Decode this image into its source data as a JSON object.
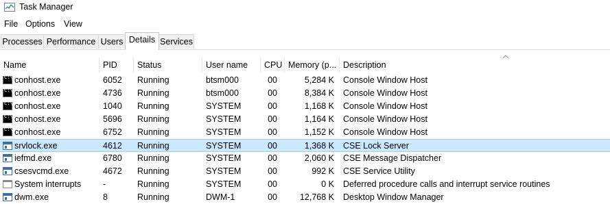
{
  "window": {
    "title": "Task Manager",
    "icon": "task-manager-icon"
  },
  "menu": [
    {
      "label": "File"
    },
    {
      "label": "Options"
    },
    {
      "label": "View"
    }
  ],
  "tabs": [
    {
      "label": "Processes",
      "active": false
    },
    {
      "label": "Performance",
      "active": false
    },
    {
      "label": "Users",
      "active": false
    },
    {
      "label": "Details",
      "active": true
    },
    {
      "label": "Services",
      "active": false
    }
  ],
  "columns": {
    "name": "Name",
    "pid": "PID",
    "status": "Status",
    "user": "User name",
    "cpu": "CPU",
    "memory": "Memory (p...",
    "description": "Description"
  },
  "rows": [
    {
      "icon": "console-icon",
      "name": "conhost.exe",
      "pid": "6052",
      "status": "Running",
      "user": "btsm000",
      "cpu": "00",
      "memory": "5,284 K",
      "description": "Console Window Host",
      "selected": false
    },
    {
      "icon": "console-icon",
      "name": "conhost.exe",
      "pid": "4736",
      "status": "Running",
      "user": "btsm000",
      "cpu": "00",
      "memory": "8,384 K",
      "description": "Console Window Host",
      "selected": false
    },
    {
      "icon": "console-icon",
      "name": "conhost.exe",
      "pid": "1040",
      "status": "Running",
      "user": "SYSTEM",
      "cpu": "00",
      "memory": "1,168 K",
      "description": "Console Window Host",
      "selected": false
    },
    {
      "icon": "console-icon",
      "name": "conhost.exe",
      "pid": "5696",
      "status": "Running",
      "user": "SYSTEM",
      "cpu": "00",
      "memory": "1,164 K",
      "description": "Console Window Host",
      "selected": false
    },
    {
      "icon": "console-icon",
      "name": "conhost.exe",
      "pid": "6752",
      "status": "Running",
      "user": "SYSTEM",
      "cpu": "00",
      "memory": "1,152 K",
      "description": "Console Window Host",
      "selected": false
    },
    {
      "icon": "app-window-icon",
      "name": "srvlock.exe",
      "pid": "4612",
      "status": "Running",
      "user": "SYSTEM",
      "cpu": "00",
      "memory": "1,368 K",
      "description": "CSE Lock Server",
      "selected": true
    },
    {
      "icon": "app-window-icon",
      "name": "iefmd.exe",
      "pid": "6780",
      "status": "Running",
      "user": "SYSTEM",
      "cpu": "00",
      "memory": "2,060 K",
      "description": "CSE Message Dispatcher",
      "selected": false
    },
    {
      "icon": "app-window-icon",
      "name": "csesvcmd.exe",
      "pid": "4672",
      "status": "Running",
      "user": "SYSTEM",
      "cpu": "00",
      "memory": "992 K",
      "description": "CSE Service Utility",
      "selected": false
    },
    {
      "icon": "plain-window-icon",
      "name": "System interrupts",
      "pid": "-",
      "status": "Running",
      "user": "SYSTEM",
      "cpu": "00",
      "memory": "0 K",
      "description": "Deferred procedure calls and interrupt service routines",
      "selected": false
    },
    {
      "icon": "app-window-icon",
      "name": "dwm.exe",
      "pid": "8",
      "status": "Running",
      "user": "DWM-1",
      "cpu": "00",
      "memory": "12,768 K",
      "description": "Desktop Window Manager",
      "selected": false
    }
  ],
  "colors": {
    "selection": "#cce8ff",
    "selection_border": "#99d1ff"
  }
}
